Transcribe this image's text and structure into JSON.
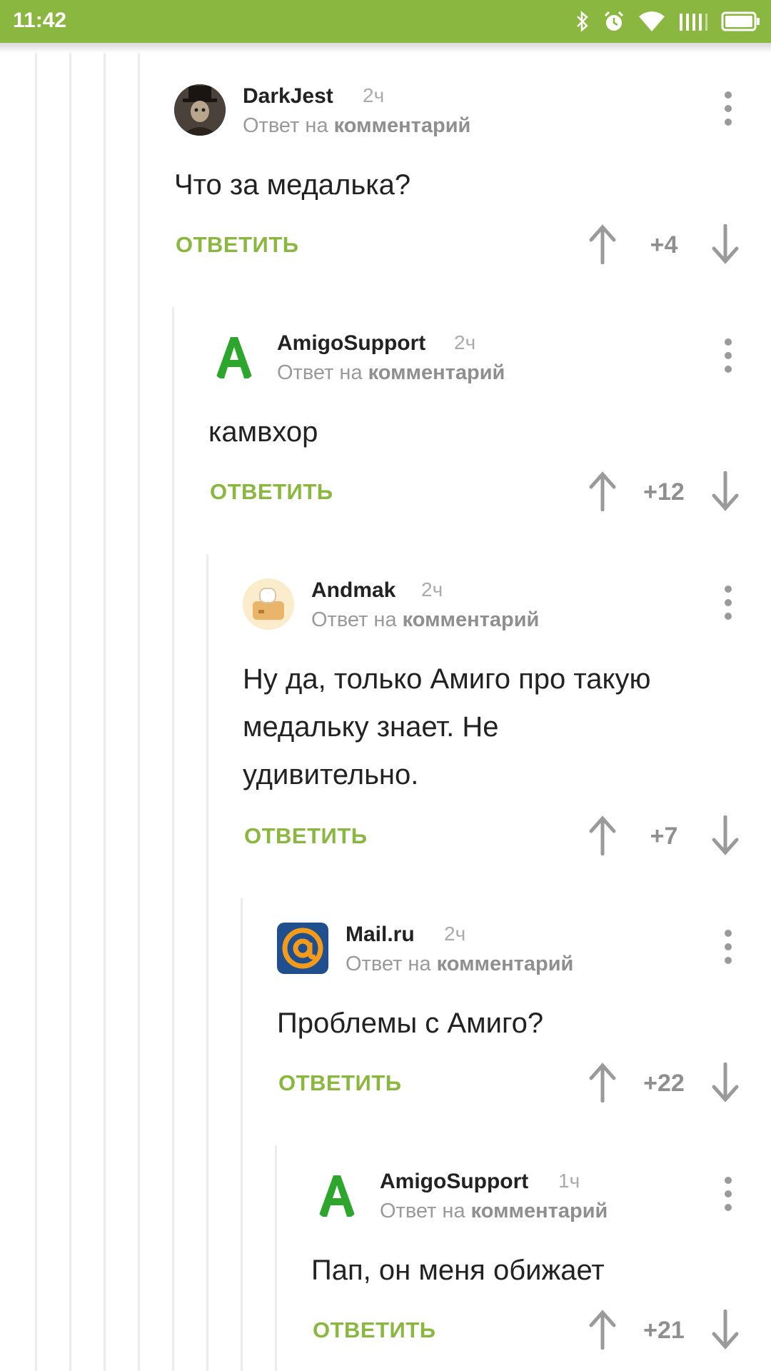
{
  "status_bar": {
    "time": "11:42"
  },
  "ui": {
    "reply_label": "ОТВЕТИТЬ",
    "reply_to_prefix": "Ответ на",
    "reply_to_link": "комментарий"
  },
  "comments": [
    {
      "author": "DarkJest",
      "time": "2ч",
      "text": "Что за медалька?",
      "score": "+4",
      "avatar": "photo"
    },
    {
      "author": "AmigoSupport",
      "time": "2ч",
      "text": "камвхор",
      "score": "+12",
      "avatar": "amigo-logo"
    },
    {
      "author": "Andmak",
      "time": "2ч",
      "text": "Ну да, только Амиго про такую медальку знает. Не удивительно.",
      "score": "+7",
      "avatar": "toaster"
    },
    {
      "author": "Mail.ru",
      "time": "2ч",
      "text": "Проблемы с Амиго?",
      "score": "+22",
      "avatar": "mailru-logo"
    },
    {
      "author": "AmigoSupport",
      "time": "1ч",
      "text": "Пап, он меня обижает",
      "score": "+21",
      "avatar": "amigo-logo"
    }
  ],
  "colors": {
    "accent": "#8ab73f",
    "muted": "#9a9a9a",
    "thread_line": "#ececec"
  }
}
